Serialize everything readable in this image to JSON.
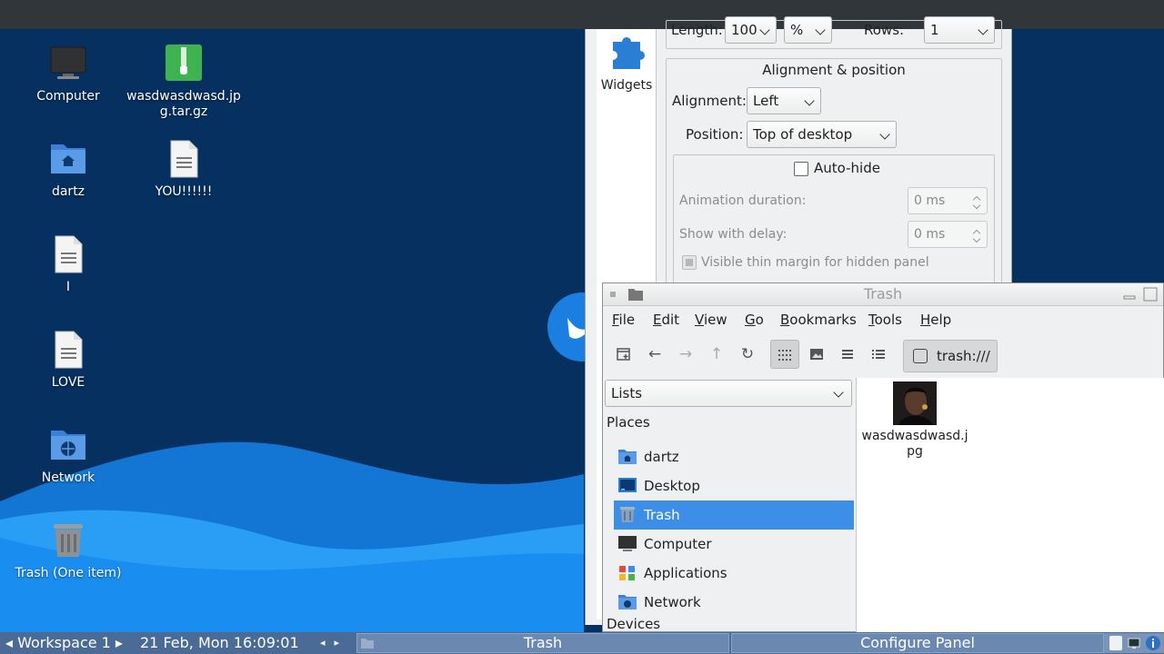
{
  "desktop": {
    "icons": [
      {
        "label": "Computer",
        "icon": "computer-icon"
      },
      {
        "label": "wasdwasdwasd.jpg.tar.gz",
        "icon": "archive-icon"
      },
      {
        "label": "dartz",
        "icon": "home-folder-icon"
      },
      {
        "label": "YOU!!!!!!",
        "icon": "text-file-icon"
      },
      {
        "label": "I",
        "icon": "text-file-icon"
      },
      {
        "label": "LOVE",
        "icon": "text-file-icon"
      },
      {
        "label": "Network",
        "icon": "network-folder-icon"
      },
      {
        "label": "Trash (One item)",
        "icon": "trash-icon"
      }
    ],
    "colors": {
      "background": "#05305f",
      "wave_light": "#2a9df4",
      "wave_mid": "#1476d4"
    }
  },
  "config_panel": {
    "sidebar_label": "Widgets",
    "length_label": "Length:",
    "length_value": "100",
    "length_unit": "%",
    "rows_label": "Rows:",
    "rows_value": "1",
    "section_title": "Alignment & position",
    "alignment_label": "Alignment:",
    "alignment_value": "Left",
    "position_label": "Position:",
    "position_value": "Top of desktop",
    "autohide_label": "Auto-hide",
    "autohide_checked": false,
    "animation_label": "Animation duration:",
    "animation_value": "0 ms",
    "delay_label": "Show with delay:",
    "delay_value": "0 ms",
    "thin_margin_label": "Visible thin margin for hidden panel"
  },
  "trash_window": {
    "title": "Trash",
    "menu": [
      "File",
      "Edit",
      "View",
      "Go",
      "Bookmarks",
      "Tools",
      "Help"
    ],
    "location": "trash:///",
    "side_pane_mode": "Lists",
    "places_header": "Places",
    "places": [
      {
        "label": "dartz",
        "icon": "home-folder-icon",
        "selected": false
      },
      {
        "label": "Desktop",
        "icon": "desktop-icon",
        "selected": false
      },
      {
        "label": "Trash",
        "icon": "trash-icon",
        "selected": true
      },
      {
        "label": "Computer",
        "icon": "computer-icon",
        "selected": false
      },
      {
        "label": "Applications",
        "icon": "applications-icon",
        "selected": false
      },
      {
        "label": "Network",
        "icon": "network-folder-icon",
        "selected": false
      }
    ],
    "devices_header": "Devices",
    "files": [
      {
        "name": "wasdwasdwasd.jpg"
      }
    ]
  },
  "taskbar": {
    "workspace": "Workspace 1",
    "clock": "21 Feb, Mon 16:09:01",
    "tasks": [
      {
        "label": "Trash"
      },
      {
        "label": "Configure Panel"
      }
    ]
  }
}
